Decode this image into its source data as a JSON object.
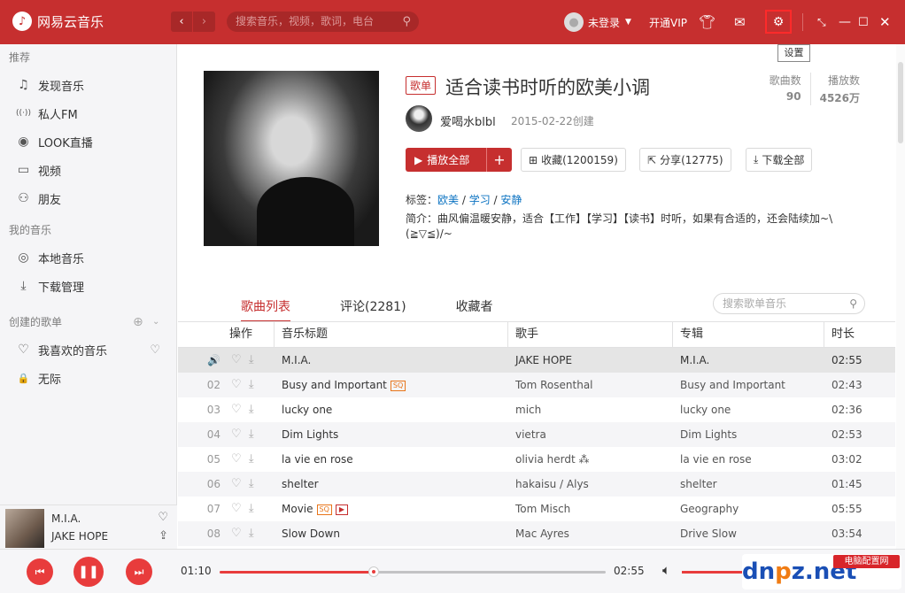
{
  "app": {
    "name": "网易云音乐"
  },
  "titlebar": {
    "search_placeholder": "搜索音乐，视频，歌词，电台",
    "login": "未登录",
    "vip": "开通VIP",
    "settings_tooltip": "设置"
  },
  "sidebar": {
    "sections": [
      {
        "title": "推荐",
        "items": [
          {
            "label": "发现音乐",
            "icon": "♫"
          },
          {
            "label": "私人FM",
            "icon": "((·))"
          },
          {
            "label": "LOOK直播",
            "icon": "◉"
          },
          {
            "label": "视频",
            "icon": "▭"
          },
          {
            "label": "朋友",
            "icon": "⚇"
          }
        ]
      },
      {
        "title": "我的音乐",
        "items": [
          {
            "label": "本地音乐",
            "icon": "◎"
          },
          {
            "label": "下载管理",
            "icon": "⤓"
          }
        ]
      },
      {
        "title": "创建的歌单",
        "items": [
          {
            "label": "我喜欢的音乐",
            "icon": "♡"
          },
          {
            "label": "无际",
            "icon": "🔒"
          }
        ]
      }
    ],
    "now_playing": {
      "title": "M.I.A.",
      "artist": "JAKE HOPE"
    }
  },
  "playlist": {
    "tag": "歌单",
    "title": "适合读书时听的欧美小调",
    "creator": "爱喝水blbl",
    "created": "2015-02-22创建",
    "stats": {
      "songs_label": "歌曲数",
      "songs": "90",
      "plays_label": "播放数",
      "plays": "4526万"
    },
    "buttons": {
      "play_all": "播放全部",
      "collect": "收藏(1200159)",
      "share": "分享(12775)",
      "download_all": "下载全部"
    },
    "tags_label": "标签：",
    "tags": [
      "欧美",
      "学习",
      "安静"
    ],
    "intro_label": "简介：",
    "intro": "曲风偏温暖安静，适合【工作】【学习】【读书】时听，如果有合适的，还会陆续加~\\(≧▽≦)/~"
  },
  "tabs": [
    {
      "label": "歌曲列表",
      "active": true
    },
    {
      "label": "评论(2281)",
      "active": false
    },
    {
      "label": "收藏者",
      "active": false
    }
  ],
  "tab_search_placeholder": "搜索歌单音乐",
  "table": {
    "headers": {
      "ops": "操作",
      "title": "音乐标题",
      "artist": "歌手",
      "album": "专辑",
      "duration": "时长"
    },
    "rows": [
      {
        "idx": "🔊",
        "title": "M.I.A.",
        "artist": "JAKE HOPE",
        "album": "M.I.A.",
        "duration": "02:55",
        "sq": "",
        "mv": ""
      },
      {
        "idx": "02",
        "title": "Busy and Important",
        "artist": "Tom Rosenthal",
        "album": "Busy and Important",
        "duration": "02:43",
        "sq": "SQ",
        "mv": ""
      },
      {
        "idx": "03",
        "title": "lucky one",
        "artist": "mich",
        "album": "lucky one",
        "duration": "02:36",
        "sq": "",
        "mv": ""
      },
      {
        "idx": "04",
        "title": "Dim Lights",
        "artist": "vietra",
        "album": "Dim Lights",
        "duration": "02:53",
        "sq": "",
        "mv": ""
      },
      {
        "idx": "05",
        "title": "la vie en rose",
        "artist": "olivia herdt ⁂",
        "album": "la vie en rose",
        "duration": "03:02",
        "sq": "",
        "mv": ""
      },
      {
        "idx": "06",
        "title": "shelter",
        "artist": "hakaisu / Alys",
        "album": "shelter",
        "duration": "01:45",
        "sq": "",
        "mv": ""
      },
      {
        "idx": "07",
        "title": "Movie",
        "artist": "Tom Misch",
        "album": "Geography",
        "duration": "05:55",
        "sq": "SQ",
        "mv": "▶"
      },
      {
        "idx": "08",
        "title": "Slow Down",
        "artist": "Mac Ayres",
        "album": "Drive Slow",
        "duration": "03:54",
        "sq": "",
        "mv": ""
      }
    ]
  },
  "player": {
    "current": "01:10",
    "total": "02:55",
    "progress": 0.4
  },
  "watermark": {
    "brand_a": "dn",
    "brand_o": "p",
    "brand_b": "z.net",
    "tag": "电脑配置网"
  },
  "colors": {
    "brand_red": "#c62f2f",
    "accent": "#e83c3c"
  }
}
